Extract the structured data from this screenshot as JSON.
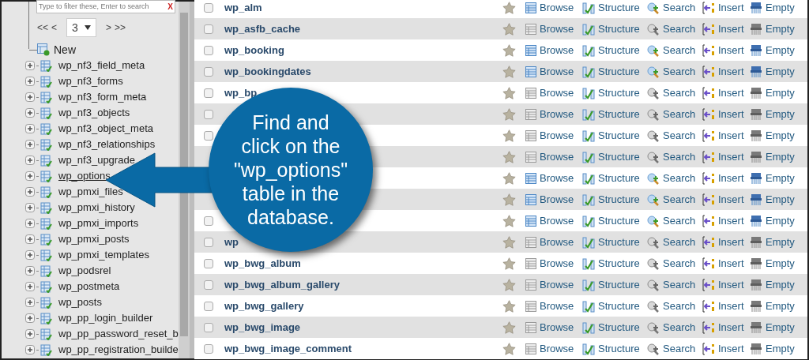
{
  "sidebar": {
    "filter": {
      "placeholder": "Type to filter these, Enter to search",
      "clear": "X"
    },
    "pager": {
      "first": "<<",
      "prev": "<",
      "page": "3",
      "next": ">",
      "last": ">>"
    },
    "new_item": "New",
    "tables": [
      {
        "name": "wp_nf3_field_meta",
        "hovered": false
      },
      {
        "name": "wp_nf3_forms",
        "hovered": false
      },
      {
        "name": "wp_nf3_form_meta",
        "hovered": false
      },
      {
        "name": "wp_nf3_objects",
        "hovered": false
      },
      {
        "name": "wp_nf3_object_meta",
        "hovered": false
      },
      {
        "name": "wp_nf3_relationships",
        "hovered": false
      },
      {
        "name": "wp_nf3_upgrade",
        "hovered": false
      },
      {
        "name": "wp_options",
        "hovered": true
      },
      {
        "name": "wp_pmxi_files",
        "hovered": false
      },
      {
        "name": "wp_pmxi_history",
        "hovered": false
      },
      {
        "name": "wp_pmxi_imports",
        "hovered": false
      },
      {
        "name": "wp_pmxi_posts",
        "hovered": false
      },
      {
        "name": "wp_pmxi_templates",
        "hovered": false
      },
      {
        "name": "wp_podsrel",
        "hovered": false
      },
      {
        "name": "wp_postmeta",
        "hovered": false
      },
      {
        "name": "wp_posts",
        "hovered": false
      },
      {
        "name": "wp_pp_login_builder",
        "hovered": false
      },
      {
        "name": "wp_pp_password_reset_b",
        "hovered": false
      },
      {
        "name": "wp_pp_registration_builde",
        "hovered": false
      }
    ]
  },
  "tables": [
    {
      "name": "wp_alm",
      "checked": false,
      "favorite": false,
      "empty": false,
      "actions": [
        "Browse",
        "Structure",
        "Search",
        "Insert",
        "Empty"
      ]
    },
    {
      "name": "wp_asfb_cache",
      "checked": false,
      "favorite": false,
      "empty": true,
      "actions": [
        "Browse",
        "Structure",
        "Search",
        "Insert",
        "Empty"
      ]
    },
    {
      "name": "wp_booking",
      "checked": false,
      "favorite": false,
      "empty": false,
      "actions": [
        "Browse",
        "Structure",
        "Search",
        "Insert",
        "Empty"
      ]
    },
    {
      "name": "wp_bookingdates",
      "checked": false,
      "favorite": false,
      "empty": false,
      "actions": [
        "Browse",
        "Structure",
        "Search",
        "Insert",
        "Empty"
      ]
    },
    {
      "name": "wp_bp",
      "checked": false,
      "favorite": false,
      "empty": true,
      "actions": [
        "Browse",
        "Structure",
        "Search",
        "Insert",
        "Empty"
      ]
    },
    {
      "checked": false,
      "favorite": false,
      "empty": true,
      "actions": [
        "Browse",
        "Structure",
        "Search",
        "Insert",
        "Empty"
      ]
    },
    {
      "checked": false,
      "favorite": false,
      "empty": true,
      "actions": [
        "Browse",
        "Structure",
        "Search",
        "Insert",
        "Empty"
      ]
    },
    {
      "favorite": false,
      "empty": true,
      "actions": [
        "Browse",
        "Structure",
        "Search",
        "Insert",
        "Empty"
      ]
    },
    {
      "favorite": false,
      "empty": false,
      "actions": [
        "Browse",
        "Structure",
        "Search",
        "Insert",
        "Empty"
      ]
    },
    {
      "favorite": false,
      "empty": false,
      "actions": [
        "Browse",
        "Structure",
        "Search",
        "Insert",
        "Empty"
      ]
    },
    {
      "checked": false,
      "favorite": false,
      "empty": false,
      "actions": [
        "Browse",
        "Structure",
        "Search",
        "Insert",
        "Empty"
      ]
    },
    {
      "name": "wp",
      "checked": false,
      "favorite": false,
      "empty": true,
      "actions": [
        "Browse",
        "Structure",
        "Search",
        "Insert",
        "Empty"
      ]
    },
    {
      "name": "wp_bwg_album",
      "checked": false,
      "favorite": false,
      "empty": true,
      "actions": [
        "Browse",
        "Structure",
        "Search",
        "Insert",
        "Empty"
      ]
    },
    {
      "name": "wp_bwg_album_gallery",
      "checked": false,
      "favorite": false,
      "empty": true,
      "actions": [
        "Browse",
        "Structure",
        "Search",
        "Insert",
        "Empty"
      ]
    },
    {
      "name": "wp_bwg_gallery",
      "checked": false,
      "favorite": false,
      "empty": true,
      "actions": [
        "Browse",
        "Structure",
        "Search",
        "Insert",
        "Empty"
      ]
    },
    {
      "name": "wp_bwg_image",
      "checked": false,
      "favorite": false,
      "empty": true,
      "actions": [
        "Browse",
        "Structure",
        "Search",
        "Insert",
        "Empty"
      ]
    },
    {
      "name": "wp_bwg_image_comment",
      "checked": false,
      "favorite": false,
      "empty": true,
      "actions": [
        "Browse",
        "Structure",
        "Search",
        "Insert",
        "Empty"
      ]
    }
  ],
  "callout": {
    "text": "Find and\nclick on the\n\"wp_options\"\ntable in the\ndatabase."
  }
}
